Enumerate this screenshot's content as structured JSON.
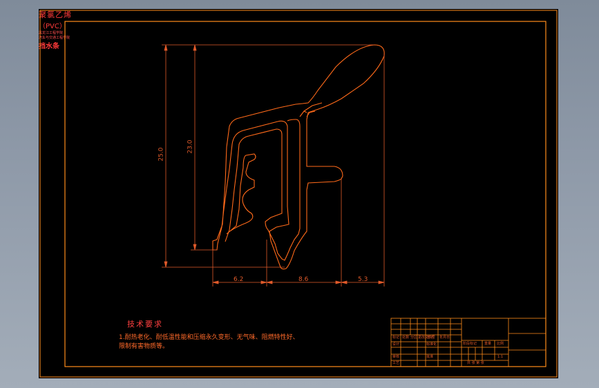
{
  "drawing": {
    "dimensions": {
      "overall_height": "25.0",
      "inner_height": "23.0",
      "width_left": "6.2",
      "width_middle": "8.6",
      "width_right": "5.3"
    },
    "technical_requirements": {
      "title": "技术要求",
      "line1": "1.耐热老化、耐低温性能和压缩永久变形、无气味、阻燃特性好、",
      "line2": "限制有害物质等。"
    },
    "title_block": {
      "material": "聚氯乙烯",
      "material_code": "（PVC）",
      "part_name": "挡水条",
      "school_line1": "黑龙江工程学院",
      "school_line2": "汽车与交通工程学院",
      "cells": {
        "mark": "标记",
        "count": "处数",
        "zone": "分区",
        "change_no": "更改文件号",
        "signature": "签名",
        "date": "年月日",
        "design": "设计",
        "standardize": "标准化",
        "review": "审核",
        "process": "工艺",
        "approve": "批准",
        "stage_mark": "阶段标记",
        "weight": "重量",
        "scale": "比例",
        "scale_value": "1:1",
        "sheets": "共 张 第 张"
      }
    },
    "colors": {
      "background": "#000000",
      "border": "#ff8c1a",
      "profile": "#ff6a1a",
      "dimension": "#e05a2a",
      "text_red": "#ff3a3a"
    }
  }
}
